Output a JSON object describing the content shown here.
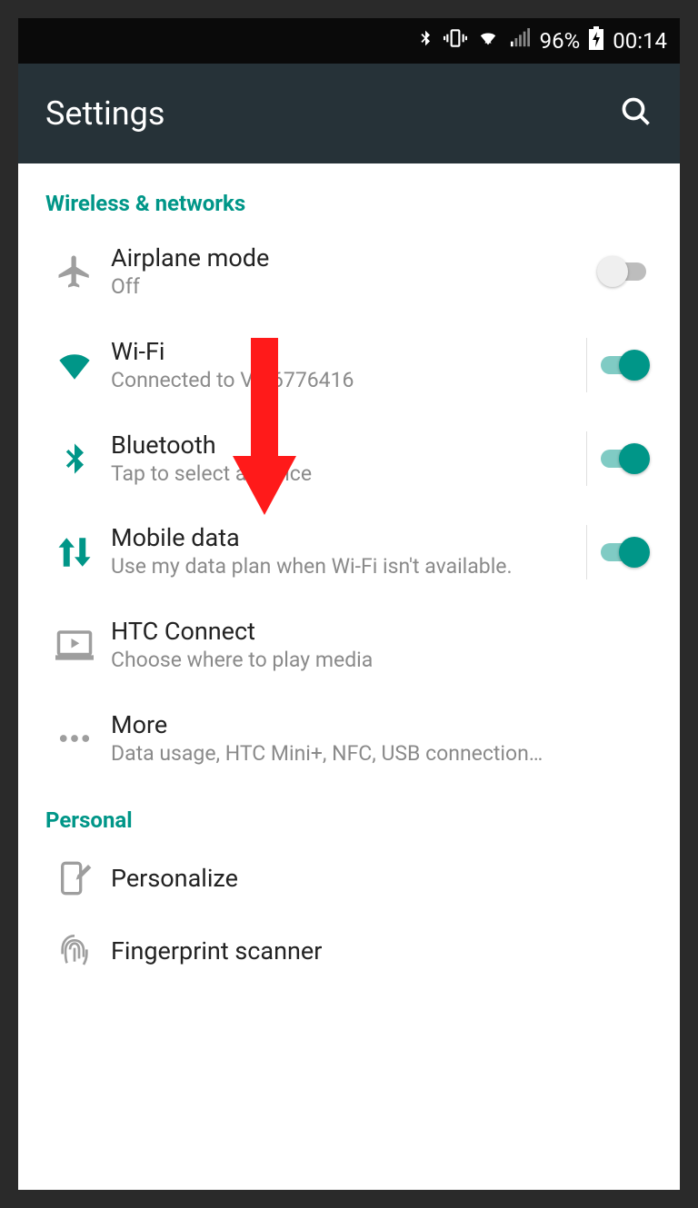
{
  "statusbar": {
    "battery_pct": "96%",
    "time": "00:14"
  },
  "appbar": {
    "title": "Settings"
  },
  "sections": {
    "wireless": {
      "header": "Wireless & networks",
      "items": [
        {
          "key": "airplane",
          "title": "Airplane mode",
          "sub": "Off",
          "toggle": "off"
        },
        {
          "key": "wifi",
          "title": "Wi-Fi",
          "sub": "Connected to VM6776416",
          "toggle": "on"
        },
        {
          "key": "bluetooth",
          "title": "Bluetooth",
          "sub": "Tap to select a device",
          "toggle": "on"
        },
        {
          "key": "mobiledata",
          "title": "Mobile data",
          "sub": "Use my data plan when Wi-Fi isn't available.",
          "toggle": "on"
        },
        {
          "key": "htcconnect",
          "title": "HTC Connect",
          "sub": "Choose where to play media"
        },
        {
          "key": "more",
          "title": "More",
          "sub": "Data usage, HTC Mini+, NFC, USB connection…"
        }
      ]
    },
    "personal": {
      "header": "Personal",
      "items": [
        {
          "key": "personalize",
          "title": "Personalize"
        },
        {
          "key": "fingerprint",
          "title": "Fingerprint scanner"
        }
      ]
    }
  },
  "colors": {
    "accent": "#009688",
    "appbar": "#263238",
    "muted_icon": "#9e9e9e"
  },
  "annotation": {
    "arrow_target": "mobiledata"
  }
}
